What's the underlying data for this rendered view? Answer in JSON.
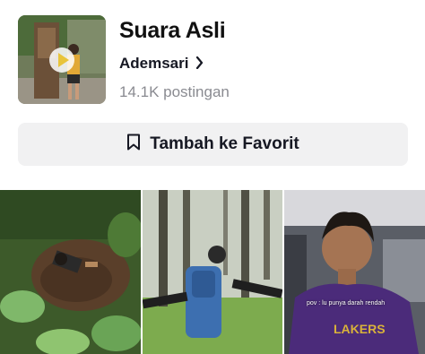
{
  "sound": {
    "title": "Suara Asli",
    "author": "Ademsari",
    "post_count": "14.1K postingan"
  },
  "actions": {
    "favorite_label": "Tambah ke Favorit"
  },
  "videos": [
    {
      "caption": ""
    },
    {
      "caption": ""
    },
    {
      "caption": "pov : lu punya darah rendah"
    }
  ],
  "icons": {
    "play": "play-icon",
    "chevron": "chevron-right-icon",
    "bookmark": "bookmark-icon"
  }
}
